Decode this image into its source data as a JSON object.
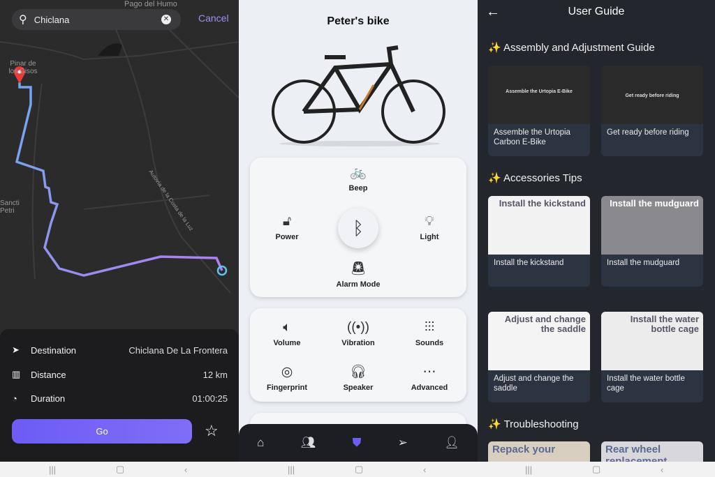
{
  "map": {
    "search_value": "Chiclana",
    "cancel_label": "Cancel",
    "labels": [
      "Pago del Humo",
      "Pinar de los Gisos",
      "Sancti Petri",
      "Autovía de la Costa de la Luz"
    ],
    "route_colors": [
      "#6fa8f0",
      "#a77ff0"
    ],
    "sheet": {
      "rows": [
        {
          "icon": "navigation-arrow-icon",
          "label": "Destination",
          "value": "Chiclana De La Frontera"
        },
        {
          "icon": "map-icon",
          "label": "Distance",
          "value": "12 km"
        },
        {
          "icon": "clock-icon",
          "label": "Duration",
          "value": "01:00:25"
        }
      ],
      "go_label": "Go",
      "accent": "#6d5cf5"
    }
  },
  "bike": {
    "title": "Peter's bike",
    "main": {
      "beep": "Beep",
      "power": "Power",
      "light": "Light",
      "alarm": "Alarm Mode"
    },
    "settings": [
      "Volume",
      "Vibration",
      "Sounds",
      "Fingerprint",
      "Speaker",
      "Advanced"
    ],
    "nav": [
      "home-icon",
      "people-icon",
      "shield-icon",
      "navigation-icon",
      "profile-icon"
    ]
  },
  "guide": {
    "title": "User Guide",
    "sections": [
      {
        "title": "Assembly and Adjustment Guide",
        "items": [
          {
            "caption": "Assemble the Urtopia Carbon E-Bike",
            "thumb": "Assemble the Urtopia E-Bike"
          },
          {
            "caption": "Get ready before riding",
            "thumb": "Get ready before riding"
          }
        ]
      },
      {
        "title": "Accessories Tips",
        "items": [
          {
            "caption": "Install the kickstand",
            "thumb": "Install the kickstand"
          },
          {
            "caption": "Install the mudguard",
            "thumb": "Install the mudguard"
          },
          {
            "caption": "Adjust and change the saddle",
            "thumb": "Adjust and change the saddle"
          },
          {
            "caption": "Install the water bottle cage",
            "thumb": "Install the water bottle cage"
          }
        ]
      },
      {
        "title": "Troubleshooting",
        "items": [
          {
            "thumb": "Repack your"
          },
          {
            "thumb": "Rear wheel replacement"
          }
        ]
      }
    ]
  }
}
